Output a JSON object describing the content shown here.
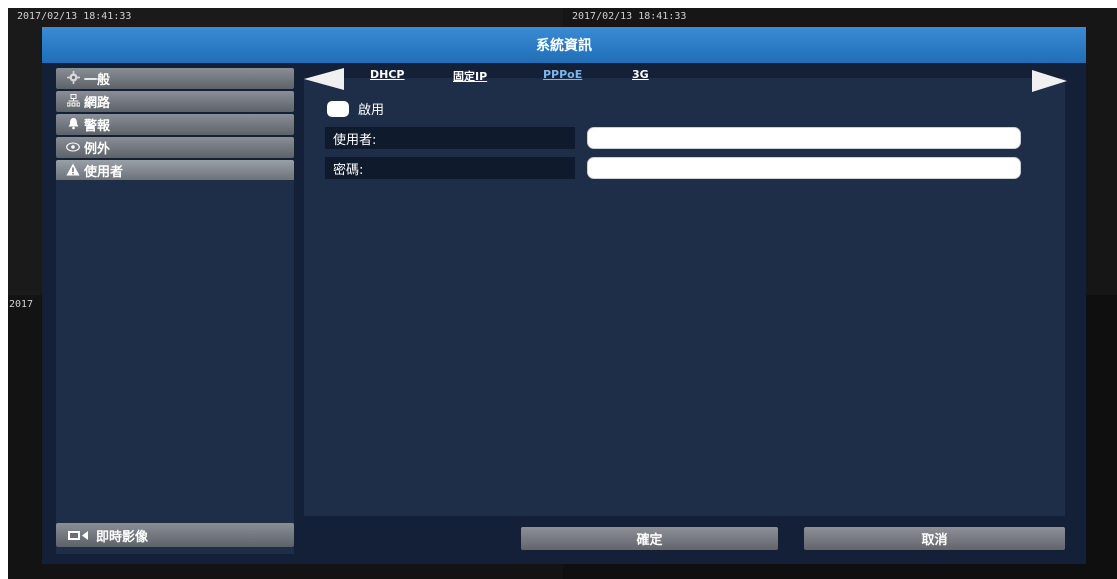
{
  "osd": {
    "timestamp_1": "2017/02/13 18:41:33",
    "timestamp_2": "2017/02/13 18:41:33",
    "timestamp_3": "2017"
  },
  "dialog": {
    "title": "系統資訊"
  },
  "sidebar": {
    "items": [
      {
        "label": "一般",
        "icon": "gear-icon"
      },
      {
        "label": "網路",
        "icon": "network-icon"
      },
      {
        "label": "警報",
        "icon": "bell-icon"
      },
      {
        "label": "例外",
        "icon": "eye-icon"
      },
      {
        "label": "使用者",
        "icon": "warning-icon"
      }
    ],
    "live_label": "即時影像"
  },
  "tabs": [
    {
      "label": "DHCP",
      "selected": false
    },
    {
      "label": "固定IP",
      "selected": false
    },
    {
      "label": "PPPoE",
      "selected": true
    },
    {
      "label": "3G",
      "selected": false
    }
  ],
  "form": {
    "enable_label": "啟用",
    "enabled": false,
    "user_label": "使用者:",
    "user_value": "",
    "password_label": "密碼:",
    "password_value": ""
  },
  "buttons": {
    "ok_label": "確定",
    "cancel_label": "取消"
  },
  "colors": {
    "titlebar": "#2a7cc7",
    "panel": "#1e2e48",
    "selected_tab": "#7fb6e8"
  }
}
